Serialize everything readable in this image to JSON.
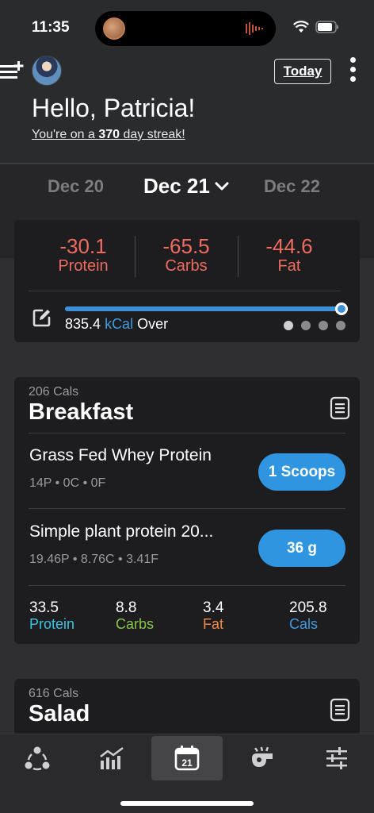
{
  "status_bar": {
    "time": "11:35"
  },
  "header": {
    "today_label": "Today",
    "greeting": "Hello, Patricia!",
    "streak_prefix": "You're on a ",
    "streak_count": "370",
    "streak_suffix": " day streak!"
  },
  "date_nav": {
    "prev": "Dec 20",
    "current": "Dec 21",
    "next": "Dec 22"
  },
  "macros": [
    {
      "value": "-30.1",
      "label": "Protein"
    },
    {
      "value": "-65.5",
      "label": "Carbs"
    },
    {
      "value": "-44.6",
      "label": "Fat"
    }
  ],
  "kcal": {
    "value": "835.4",
    "unit": "kCal",
    "status": "Over",
    "progress_fraction": 1.0
  },
  "pager": {
    "count": 4,
    "active_index": 0
  },
  "meals": [
    {
      "cals": "206 Cals",
      "title": "Breakfast",
      "foods": [
        {
          "name": "Grass Fed Whey Protein",
          "macros": "14P  •  0C  •  0F",
          "amount": "1 Scoops"
        },
        {
          "name": "Simple plant protein 20...",
          "macros": "19.46P  •  8.76C  •  3.41F",
          "amount": "36 g"
        }
      ],
      "totals": [
        {
          "value": "33.5",
          "label": "Protein",
          "color": "#3ec3e0"
        },
        {
          "value": "8.8",
          "label": "Carbs",
          "color": "#8bc34a"
        },
        {
          "value": "3.4",
          "label": "Fat",
          "color": "#f08a4b"
        },
        {
          "value": "205.8",
          "label": "Cals",
          "color": "#3f9be0"
        }
      ]
    },
    {
      "cals": "616 Cals",
      "title": "Salad"
    }
  ],
  "tabbar": {
    "items": [
      "community-icon",
      "stats-icon",
      "calendar-icon",
      "whistle-icon",
      "settings-sliders-icon"
    ],
    "active": "calendar-icon",
    "calendar_day": "21"
  },
  "colors": {
    "accent": "#2f95e0",
    "negative": "#ef6b5f",
    "card": "#1d1d1f"
  }
}
